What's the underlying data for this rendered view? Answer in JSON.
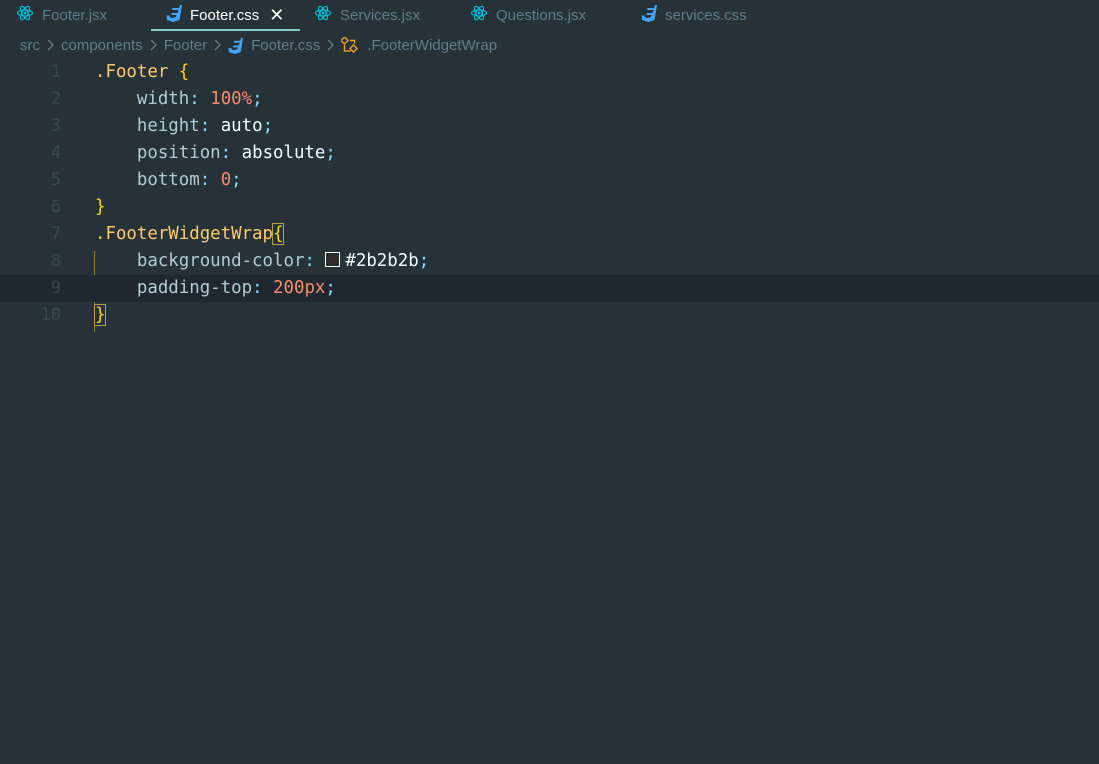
{
  "tabs": [
    {
      "label": "Footer.jsx",
      "icon": "react-icon",
      "active": false
    },
    {
      "label": "Footer.css",
      "icon": "css-icon",
      "active": true
    },
    {
      "label": "Services.jsx",
      "icon": "react-icon",
      "active": false
    },
    {
      "label": "Questions.jsx",
      "icon": "react-icon",
      "active": false
    },
    {
      "label": "services.css",
      "icon": "css-icon",
      "active": false
    }
  ],
  "breadcrumb": {
    "items": [
      "src",
      "components",
      "Footer",
      "Footer.css",
      ".FooterWidgetWrap"
    ]
  },
  "editor": {
    "line_numbers": [
      "1",
      "2",
      "3",
      "4",
      "5",
      "6",
      "7",
      "8",
      "9",
      "10"
    ],
    "current_line": 9,
    "code": {
      "l1_selector": ".Footer",
      "l1_brace": "{",
      "l2_prop": "width",
      "l2_value": "100%",
      "l3_prop": "height",
      "l3_value": "auto",
      "l4_prop": "position",
      "l4_value": "absolute",
      "l5_prop": "bottom",
      "l5_value": "0",
      "l6_brace": "}",
      "l7_selector": ".FooterWidgetWrap",
      "l7_brace": "{",
      "l8_prop": "background-color",
      "l8_value": "#2b2b2b",
      "l9_prop": "padding-top",
      "l9_value": "200px",
      "l10_brace": "}",
      "colon": ":",
      "semicolon": ";"
    }
  },
  "colors": {
    "background": "#263238",
    "selector": "#ffcb6b",
    "property": "#b2ccd6",
    "number": "#f78c6c",
    "punctuation": "#89ddff",
    "swatch": "#2b2b2b",
    "active_tab_underline": "#80cbc4"
  }
}
